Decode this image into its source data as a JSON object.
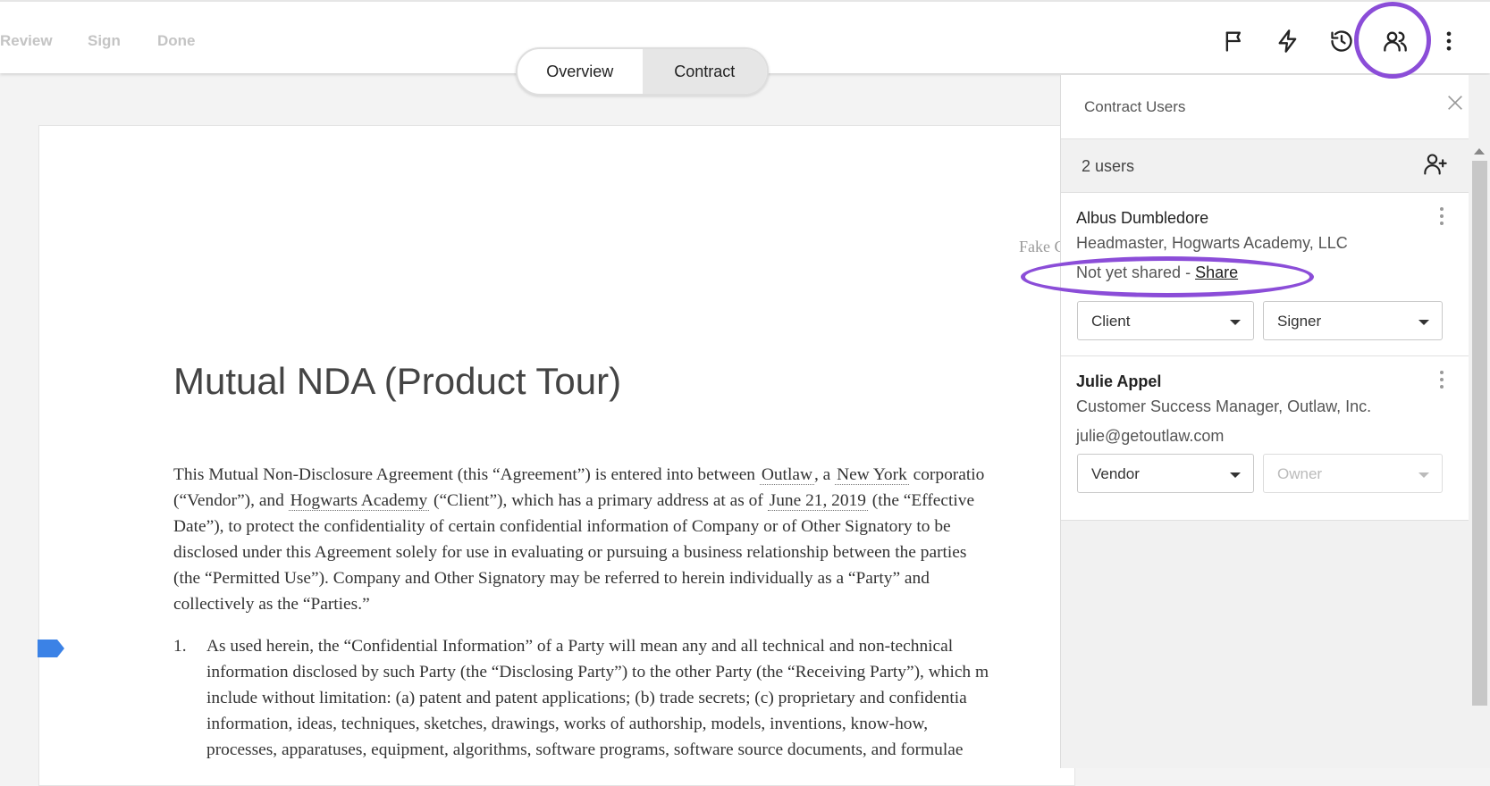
{
  "workflow_steps": [
    "Review",
    "Sign",
    "Done"
  ],
  "toolbar": {
    "icons": [
      "flag-icon",
      "lightning-icon",
      "history-icon",
      "users-icon",
      "more-vertical-icon"
    ]
  },
  "view_tabs": [
    {
      "label": "Overview",
      "active": false
    },
    {
      "label": "Contract",
      "active": true
    }
  ],
  "document": {
    "header_fragment": "Fake C",
    "title": "Mutual NDA (Product Tour)",
    "intro": {
      "l1a": "This Mutual Non-Disclosure Agreement (this “Agreement”) is entered into between ",
      "vendor_name": "Outlaw",
      "l1b": ", a ",
      "vendor_state": "New York",
      "l1c": " corporatio",
      "l2a": "(“Vendor”), and ",
      "client_name": "Hogwarts Academy",
      "l2b": " (“Client”), which has a primary address at as of ",
      "effective_date": "June 21, 2019",
      "l2c": " (the “Effective",
      "l3": "Date”), to protect the confidentiality of certain confidential information of Company or of Other Signatory to be",
      "l4": "disclosed under this Agreement solely for use in evaluating or pursuing a business relationship between the parties",
      "l5": "(the “Permitted Use”). Company and Other Signatory may be referred to herein individually as a “Party” and",
      "l6": "collectively as the “Parties.”"
    },
    "clause1": {
      "number": "1.",
      "lines": [
        "As used herein, the “Confidential Information” of a Party will mean any and all technical and non-technical",
        "information disclosed by such Party (the “Disclosing Party”) to the other Party (the “Receiving Party”), which m",
        "include without limitation: (a) patent and patent applications; (b) trade secrets; (c) proprietary and confidentia",
        "information, ideas, techniques, sketches, drawings, works of authorship, models, inventions, know-how,",
        "processes, apparatuses, equipment, algorithms, software programs, software source documents, and formulae"
      ]
    }
  },
  "panel": {
    "title": "Contract Users",
    "users_count": "2 users",
    "users": [
      {
        "name": "Albus Dumbledore",
        "role": "Headmaster, Hogwarts Academy, LLC",
        "status_prefix": "Not yet shared - ",
        "status_link": "Share",
        "party": "Client",
        "permission": "Signer",
        "permission_disabled": false
      },
      {
        "name": "Julie Appel",
        "role": "Customer Success Manager, Outlaw, Inc.",
        "email": "julie@getoutlaw.com",
        "party": "Vendor",
        "permission": "Owner",
        "permission_disabled": true
      }
    ]
  },
  "colors": {
    "highlight": "#8b4dd8",
    "marker": "#3b82e6"
  }
}
